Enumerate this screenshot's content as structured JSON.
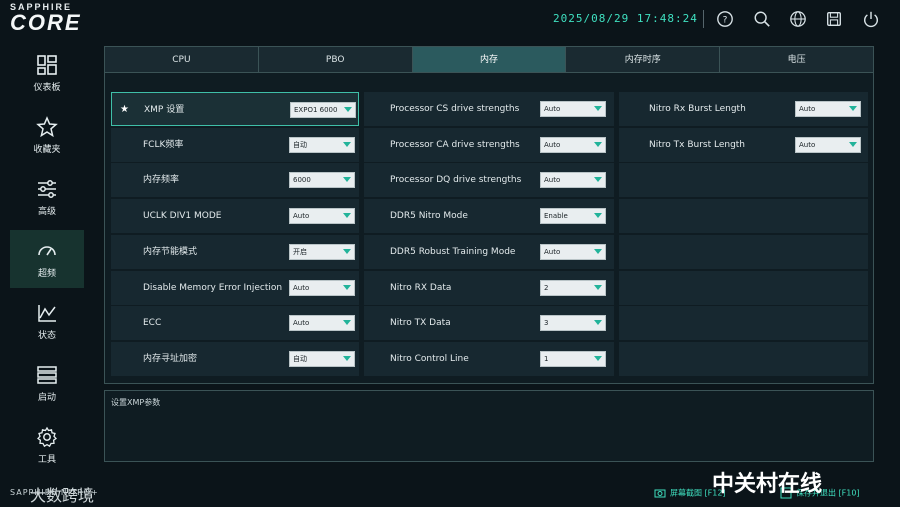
{
  "brand": {
    "small": "SAPPHIRE",
    "big": "CORE"
  },
  "clock": "2025/08/29 17:48:24",
  "sidebar": {
    "items": [
      {
        "label": "仪表板",
        "icon": "dashboard-icon"
      },
      {
        "label": "收藏夹",
        "icon": "star-icon"
      },
      {
        "label": "高级",
        "icon": "sliders-icon"
      },
      {
        "label": "超频",
        "icon": "gauge-icon"
      },
      {
        "label": "状态",
        "icon": "chart-icon"
      },
      {
        "label": "启动",
        "icon": "list-icon"
      },
      {
        "label": "工具",
        "icon": "gear-icon"
      }
    ]
  },
  "tabs": [
    "CPU",
    "PBO",
    "内存",
    "内存时序",
    "电压"
  ],
  "columns": [
    {
      "rows": [
        {
          "name": "XMP 设置",
          "value": "EXPO1 6000"
        },
        {
          "name": "FCLK频率",
          "value": "自动"
        },
        {
          "name": "内存频率",
          "value": "6000"
        },
        {
          "name": "UCLK DIV1 MODE",
          "value": "Auto"
        },
        {
          "name": "内存节能模式",
          "value": "开启"
        },
        {
          "name": "Disable Memory Error Injection",
          "value": "Auto"
        },
        {
          "name": "ECC",
          "value": "Auto"
        },
        {
          "name": "内存寻址加密",
          "value": "自动"
        }
      ]
    },
    {
      "rows": [
        {
          "name": "Processor CS drive strengths",
          "value": "Auto"
        },
        {
          "name": "Processor CA drive strengths",
          "value": "Auto"
        },
        {
          "name": "Processor DQ drive strengths",
          "value": "Auto"
        },
        {
          "name": "DDR5 Nitro Mode",
          "value": "Enable"
        },
        {
          "name": "DDR5 Robust Training Mode",
          "value": "Auto"
        },
        {
          "name": "Nitro RX Data",
          "value": "2"
        },
        {
          "name": "Nitro TX Data",
          "value": "3"
        },
        {
          "name": "Nitro Control Line",
          "value": "1"
        }
      ]
    },
    {
      "rows": [
        {
          "name": "Nitro Rx Burst Length",
          "value": "Auto"
        },
        {
          "name": "Nitro Tx Burst Length",
          "value": "Auto"
        }
      ]
    }
  ],
  "description": "设置XMP参数",
  "footer": {
    "left": "SAPPHIRE NITRO+",
    "screenshot": "屏幕截图 [F12]",
    "save_exit": "保存并退出 [F10]"
  },
  "watermark": "中关村在线",
  "watermark_left": "大数跨境",
  "colors": {
    "accent": "#3fe0c0",
    "active_tab": "#2b5a5e",
    "highlight_border": "#3fbfa8"
  }
}
